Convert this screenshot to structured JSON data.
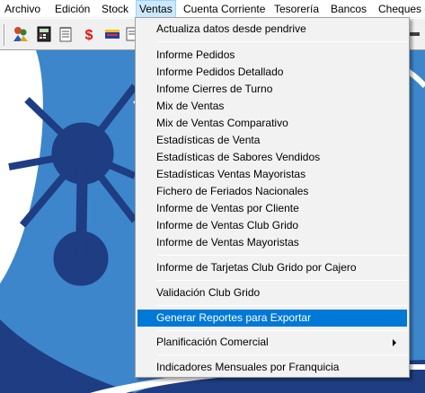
{
  "menubar": {
    "items": [
      "Archivo",
      "Edición",
      "Stock",
      "Ventas",
      "Cuenta Corriente",
      "Tesorería",
      "Bancos",
      "Cheques d"
    ]
  },
  "toolbar": {
    "icons": [
      "users-icon",
      "calculator-icon",
      "notepad-icon",
      "dollar-icon",
      "cash-icon",
      "report-icon"
    ]
  },
  "ventas_menu": {
    "items": [
      {
        "label": "Actualiza datos desde pendrive"
      },
      {
        "label": "Informe Pedidos"
      },
      {
        "label": "Informe Pedidos Detallado"
      },
      {
        "label": "Infome Cierres de Turno"
      },
      {
        "label": "Mix de Ventas"
      },
      {
        "label": "Mix de Ventas Comparativo"
      },
      {
        "label": "Estadísticas de Venta"
      },
      {
        "label": "Estadísticas de Sabores Vendidos"
      },
      {
        "label": "Estadísticas Ventas Mayoristas"
      },
      {
        "label": "Fichero de Feriados Nacionales"
      },
      {
        "label": "Informe de Ventas por Cliente"
      },
      {
        "label": "Informe de Ventas Club Grido"
      },
      {
        "label": "Informe de Ventas Mayoristas"
      },
      {
        "label": "Informe de Tarjetas Club Grido por Cajero"
      },
      {
        "label": "Validación Club Grido"
      },
      {
        "label": "Generar Reportes para Exportar",
        "highlighted": true
      },
      {
        "label": "Planificación Comercial",
        "submenu": true
      },
      {
        "label": "Indicadores Mensuales por Franquicia"
      }
    ]
  },
  "colors": {
    "background_blue": "#3d86cb",
    "highlight": "#0078d7",
    "logo_navy": "#1e3d82"
  }
}
